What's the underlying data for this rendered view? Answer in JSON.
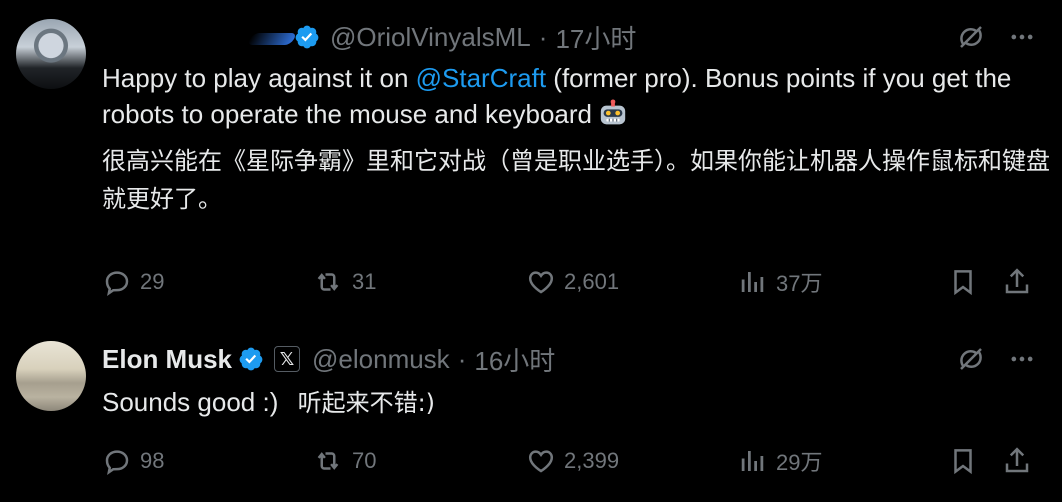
{
  "tweets": [
    {
      "handle": "@OriolVinyalsML",
      "time": "17小时",
      "text_prefix": "Happy to play against it on ",
      "mention": "@StarCraft",
      "text_suffix": " (former pro). Bonus points if you get the robots to operate the mouse and keyboard",
      "emoji": "robot-face",
      "translation": "很高兴能在《星际争霸》里和它对战（曾是职业选手）。如果你能让机器人操作鼠标和键盘就更好了。",
      "replies": "29",
      "retweets": "31",
      "likes": "2,601",
      "views": "37万"
    },
    {
      "name": "Elon Musk",
      "affiliate_badge": "𝕏",
      "handle": "@elonmusk",
      "time": "16小时",
      "text": "Sounds good :)",
      "translation": "听起来不错:)",
      "replies": "98",
      "retweets": "70",
      "likes": "2,399",
      "views": "29万"
    }
  ],
  "colors": {
    "background": "#000000",
    "text": "#e7e9ea",
    "muted": "#71767b",
    "link": "#1d9bf0",
    "verified": "#1d9bf0"
  },
  "separator": "·"
}
